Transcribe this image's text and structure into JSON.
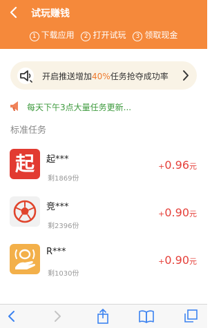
{
  "header": {
    "title": "试玩赚钱",
    "steps": [
      {
        "num": "1",
        "label": "下载应用"
      },
      {
        "num": "2",
        "label": "打开试玩"
      },
      {
        "num": "3",
        "label": "领取现金"
      }
    ]
  },
  "push_banner": {
    "text_before": "开启推送增加",
    "highlight": "40%",
    "text_after": "任务抢夺成功率"
  },
  "notice": {
    "text": "每天下午3点大量任务更新..."
  },
  "section": {
    "title": "标准任务"
  },
  "tasks": [
    {
      "name": "起***",
      "icon_char": "起",
      "remaining": "剩1869份",
      "sign": "+",
      "amount": "0.96",
      "unit": "元"
    },
    {
      "name": "竞***",
      "remaining": "剩2396份",
      "sign": "+",
      "amount": "0.90",
      "unit": "元"
    },
    {
      "name": "R***",
      "remaining": "剩1030份",
      "sign": "+",
      "amount": "0.90",
      "unit": "元"
    }
  ],
  "colors": {
    "header_bg": "#f5893b",
    "reward": "#e5403a",
    "notice": "#3d9a3d",
    "highlight": "#ee7a2e"
  },
  "icons": {
    "header": [
      "back-icon"
    ],
    "push_banner": [
      "speaker-icon",
      "chevron-right-icon"
    ],
    "notice": [
      "megaphone-icon"
    ],
    "bottom_bar": [
      "back-icon",
      "forward-icon",
      "share-icon",
      "bookmarks-icon",
      "tabs-icon"
    ]
  }
}
